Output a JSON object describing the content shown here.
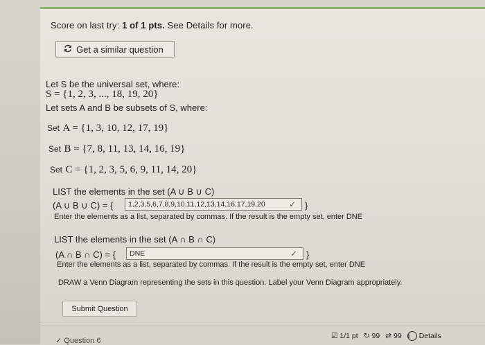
{
  "score": {
    "prefix": "Score on last try: ",
    "value": "1 of 1 pts.",
    "suffix": " See Details for more."
  },
  "similar_button": {
    "label": "Get a similar question"
  },
  "question": {
    "intro1": "Let S be the universal set, where:",
    "universal": "S = {1, 2, 3, ..., 18, 19, 20}",
    "intro2": "Let sets A and B be subsets of S, where:",
    "setA_label": "Set",
    "setA": "A = {1, 3, 10, 12, 17, 19}",
    "setB_label": "Set",
    "setB": "B = {7, 8, 11, 13, 14, 16, 19}",
    "setC_label": "Set",
    "setC": "C = {1, 2, 3, 5, 6, 9, 11, 14, 20}",
    "union_prompt": "LIST the elements in the set (A ∪ B ∪ C)",
    "union_prefix": "(A ∪ B ∪ C) = {",
    "union_value": "1,2,3,5,6,7,8,9,10,11,12,13,14,16,17,19,20",
    "union_suffix": "}",
    "instruction1": "Enter the elements as a list, separated by commas. If the result is the empty set, enter DNE",
    "intersection_prompt": "LIST the elements in the set (A ∩ B ∩ C)",
    "intersection_prefix": "(A ∩ B ∩ C) = {",
    "intersection_value": "DNE",
    "intersection_suffix": "}",
    "instruction2": "Enter the elements as a list, separated by commas. If the result is the empty set, enter DNE",
    "venn_instruction": "DRAW a Venn Diagram representing the sets in this question. Label your Venn Diagram appropriately."
  },
  "submit_button": {
    "label": "Submit Question"
  },
  "footer": {
    "next_question": "Question 6",
    "points": "1/1 pt",
    "retries": "99",
    "attempts": "99",
    "details": "Details"
  }
}
